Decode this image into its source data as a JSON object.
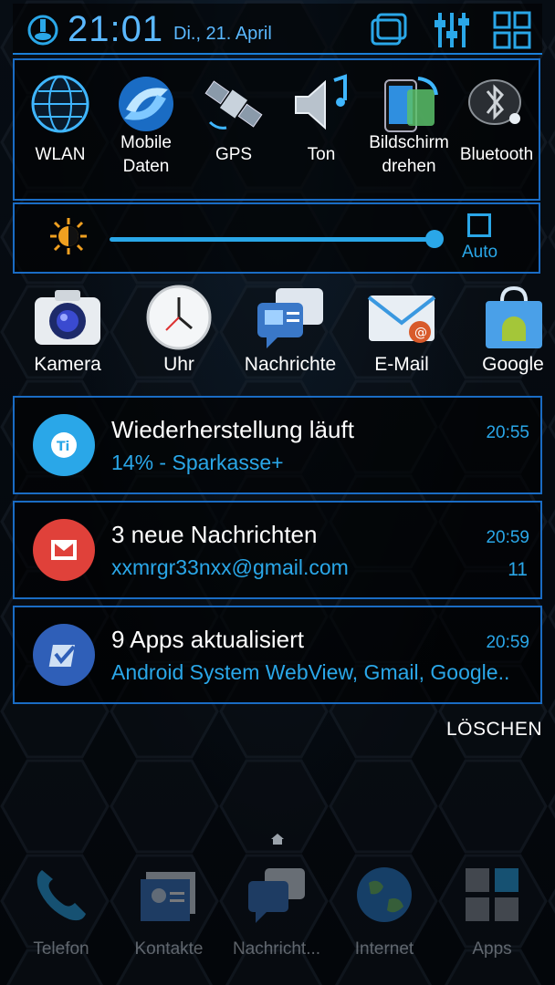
{
  "status": {
    "time": "21:01",
    "date": "Di., 21. April"
  },
  "quick_settings": [
    {
      "label": "WLAN",
      "icon": "wifi-globe-icon"
    },
    {
      "label": "Mobile Daten",
      "icon": "mobile-data-icon"
    },
    {
      "label": "GPS",
      "icon": "gps-satellite-icon"
    },
    {
      "label": "Ton",
      "icon": "sound-icon"
    },
    {
      "label": "Bildschirm drehen",
      "icon": "rotate-screen-icon"
    },
    {
      "label": "Bluetooth",
      "icon": "bluetooth-icon"
    }
  ],
  "brightness": {
    "auto_label": "Auto",
    "level_fraction": 0.97
  },
  "shortcuts": [
    {
      "label": "Kamera",
      "icon": "camera-icon"
    },
    {
      "label": "Uhr",
      "icon": "clock-icon"
    },
    {
      "label": "Nachrichte",
      "icon": "messages-icon"
    },
    {
      "label": "E-Mail",
      "icon": "email-icon"
    },
    {
      "label": "Google",
      "icon": "google-play-icon"
    }
  ],
  "notifications": [
    {
      "title": "Wiederherstellung läuft",
      "subtitle": "14% - Sparkasse+",
      "time": "20:55",
      "count": "",
      "color": "#2aa7e8",
      "icon": "titanium-backup-icon"
    },
    {
      "title": "3 neue Nachrichten",
      "subtitle": "xxmrgr33nxx@gmail.com",
      "time": "20:59",
      "count": "11",
      "color": "#e0413a",
      "icon": "gmail-icon"
    },
    {
      "title": "9 Apps aktualisiert",
      "subtitle": "Android System WebView, Gmail, Google..",
      "time": "20:59",
      "count": "",
      "color": "#2f5fb8",
      "icon": "play-store-update-icon"
    }
  ],
  "clear_label": "LÖSCHEN",
  "dock": [
    {
      "label": "Telefon",
      "icon": "phone-icon"
    },
    {
      "label": "Kontakte",
      "icon": "contacts-icon"
    },
    {
      "label": "Nachricht...",
      "icon": "messages-icon"
    },
    {
      "label": "Internet",
      "icon": "globe-icon"
    },
    {
      "label": "Apps",
      "icon": "apps-grid-icon"
    }
  ]
}
